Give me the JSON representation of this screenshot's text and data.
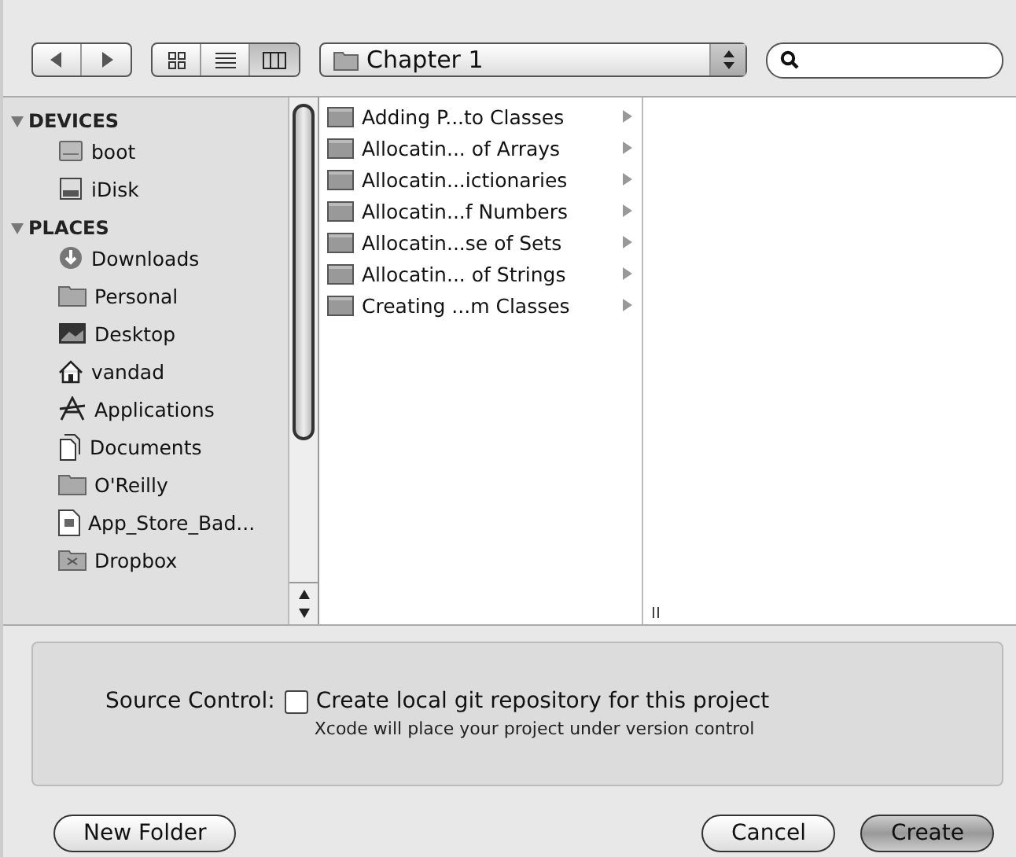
{
  "toolbar": {
    "view_modes": [
      {
        "kind": "icon",
        "selected": false
      },
      {
        "kind": "list",
        "selected": false
      },
      {
        "kind": "column",
        "selected": true
      }
    ],
    "location": "Chapter 1"
  },
  "sidebar": {
    "sections": [
      {
        "title": "DEVICES",
        "expanded": true,
        "items": [
          {
            "label": "boot",
            "kind": "disk"
          },
          {
            "label": "iDisk",
            "kind": "idisk"
          }
        ]
      },
      {
        "title": "PLACES",
        "expanded": true,
        "items": [
          {
            "label": "Downloads",
            "kind": "downloads"
          },
          {
            "label": "Personal",
            "kind": "folder"
          },
          {
            "label": "Desktop",
            "kind": "desktop"
          },
          {
            "label": "vandad",
            "kind": "home"
          },
          {
            "label": "Applications",
            "kind": "apps"
          },
          {
            "label": "Documents",
            "kind": "document"
          },
          {
            "label": "O'Reilly",
            "kind": "folder"
          },
          {
            "label": "App_Store_Bad...",
            "kind": "file"
          },
          {
            "label": "Dropbox",
            "kind": "dropbox"
          }
        ]
      }
    ]
  },
  "columns": [
    [
      {
        "label": "Adding P...to Classes"
      },
      {
        "label": "Allocatin... of Arrays"
      },
      {
        "label": "Allocatin...ictionaries"
      },
      {
        "label": "Allocatin...f Numbers"
      },
      {
        "label": "Allocatin...se of Sets"
      },
      {
        "label": "Allocatin... of Strings"
      },
      {
        "label": "Creating ...m Classes"
      }
    ]
  ],
  "options": {
    "label": "Source Control:",
    "checkbox": {
      "label": "Create local git repository for this project",
      "checked": false
    },
    "hint": "Xcode will place your project under version control"
  },
  "buttons": {
    "left": "New Folder",
    "cancel": "Cancel",
    "default": "Create"
  }
}
